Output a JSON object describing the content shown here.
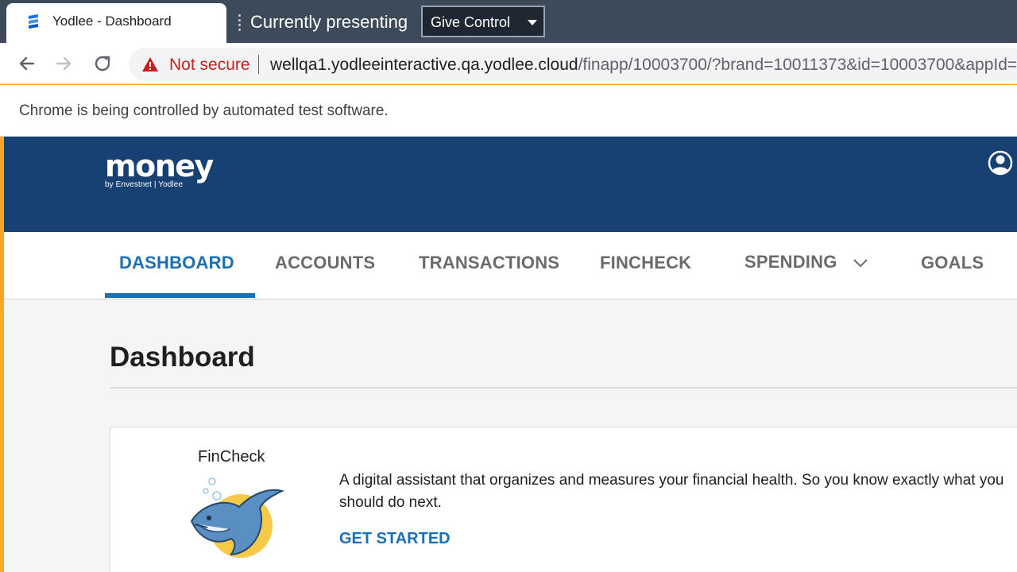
{
  "browser": {
    "tab": {
      "title": "Yodlee - Dashboard",
      "favicon": "yodlee-logo-icon"
    },
    "presenting": {
      "label": "Currently presenting",
      "control_button": "Give Control"
    },
    "toolbar": {
      "security_label": "Not secure",
      "url_host": "wellqa1.yodleeinteractive.qa.yodlee.cloud",
      "url_path": "/finapp/10003700/?brand=10011373&id=10003700&appId="
    },
    "infobar": {
      "message": "Chrome is being controlled by automated test software."
    }
  },
  "app": {
    "logo": {
      "word": "money",
      "sub": "by Envestnet | Yodlee"
    },
    "nav": {
      "items": [
        {
          "label": "DASHBOARD",
          "active": true
        },
        {
          "label": "ACCOUNTS",
          "active": false
        },
        {
          "label": "TRANSACTIONS",
          "active": false
        },
        {
          "label": "FINCHECK",
          "active": false
        },
        {
          "label": "SPENDING",
          "active": false
        },
        {
          "label": "GOALS",
          "active": false
        }
      ]
    },
    "page_title": "Dashboard",
    "fincheck_card": {
      "title": "FinCheck",
      "description": "A digital assistant that organizes and measures your financial health. So you know exactly what you should do next.",
      "cta": "GET STARTED"
    }
  },
  "colors": {
    "header_bg": "#174073",
    "accent": "#1a6fb5",
    "frame": "#f9a825",
    "warning": "#c5221f"
  }
}
